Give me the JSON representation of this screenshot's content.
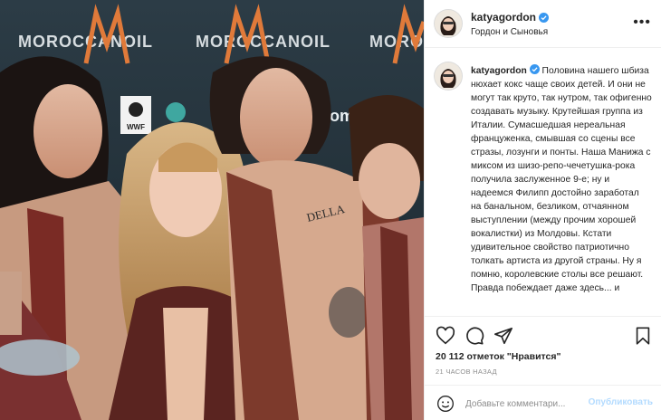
{
  "photo": {
    "description_icons": [
      "wwf-logo"
    ],
    "backdrop_brand": "MOROCCANOIL",
    "tattoo_text": "DELLA"
  },
  "header": {
    "username": "katyagordon",
    "subtitle": "Гордон и Сыновья",
    "more_icon": "ellipsis-icon"
  },
  "caption": {
    "username": "katyagordon",
    "text": "Половина нашего шбиза нюхает кокс чаще своих детей. И они не могут так круто, так нутром, так офигенно создавать музыку. Крутейшая группа из Италии. Сумасшедшая нереальная француженка, смывшая со сцены все стразы, лозунги и понты. Наша Манижа с миксом из шизо-репо-чечетушка-рока получила заслуженное 9-е; ну и надеемся Филипп достойно заработал на банальном, безликом, отчаянном выступлении (между прочим хорошей вокалистки) из Молдовы. Кстати удивительное свойство патриотично толкать артиста из другой страны. Ну я помню, королевские столы все решают. Правда побеждает даже здесь... и"
  },
  "actions": {
    "like_icon": "heart-icon",
    "comment_icon": "comment-icon",
    "share_icon": "paper-plane-icon",
    "save_icon": "bookmark-icon"
  },
  "likes": "20 112 отметок \"Нравится\"",
  "timestamp": "21 ЧАСОВ НАЗАД",
  "comment_box": {
    "emoji_icon": "smile-icon",
    "placeholder": "Добавьте комментари...",
    "post_label": "Опубликовать"
  },
  "colors": {
    "verified": "#3897f0",
    "post_disabled": "#b3dbff",
    "muted": "#8e8e8e",
    "border": "#efefef"
  }
}
